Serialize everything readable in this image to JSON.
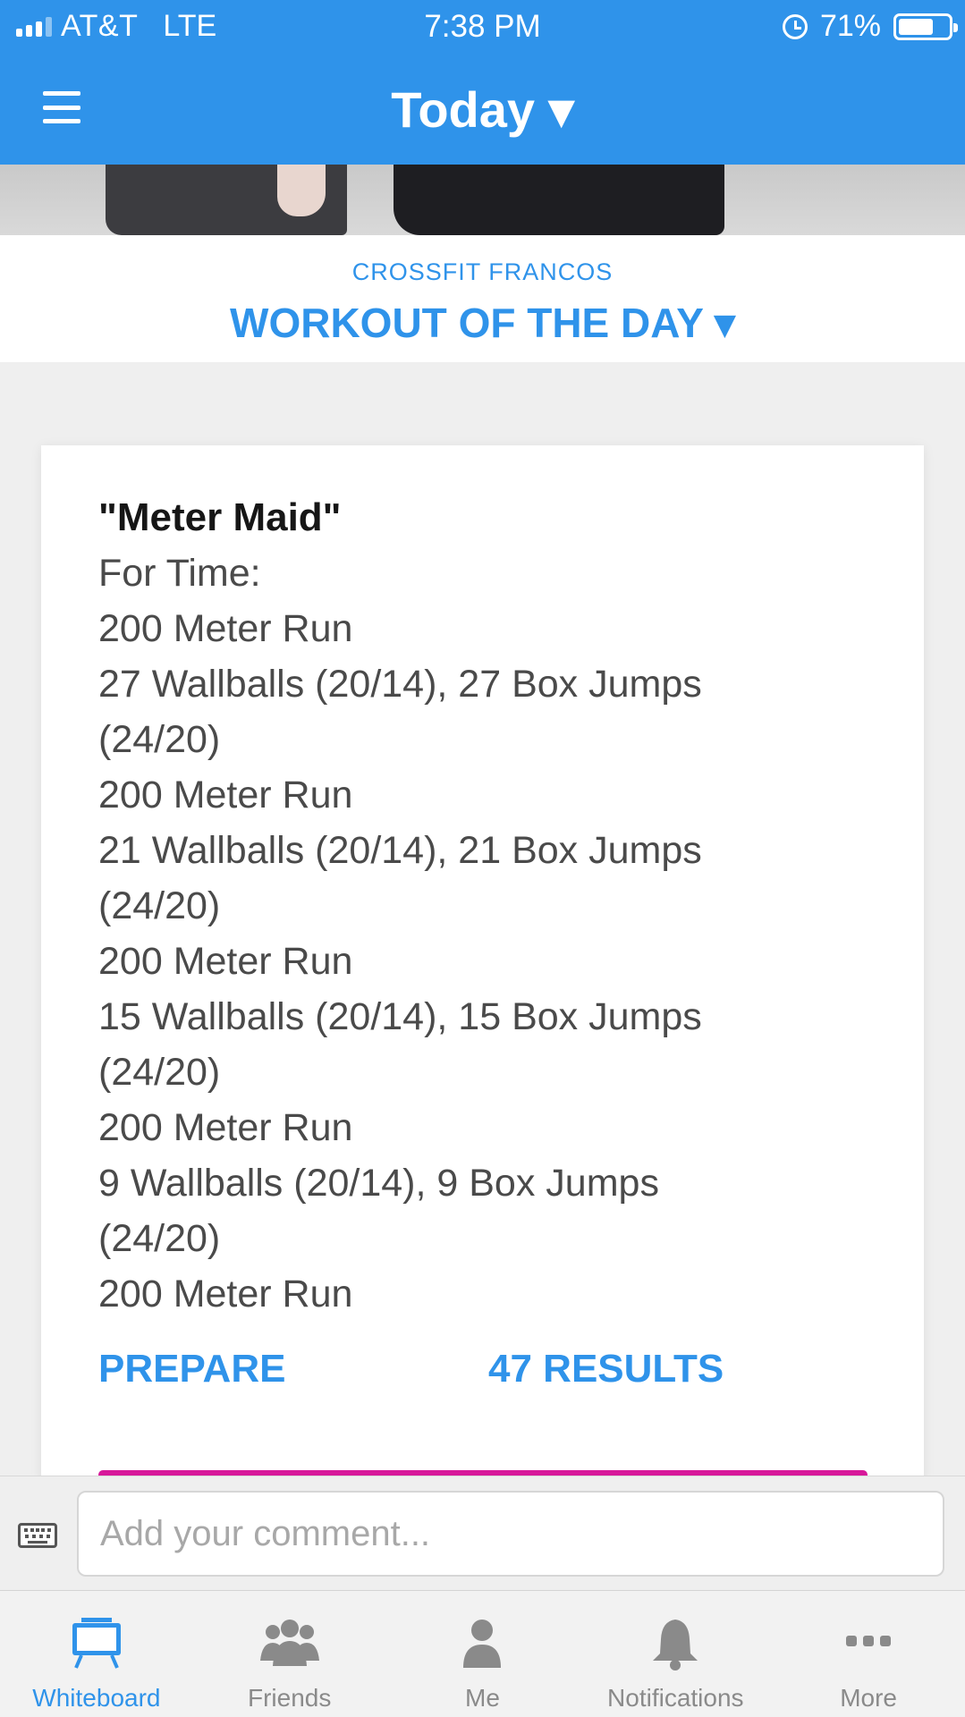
{
  "status_bar": {
    "carrier": "AT&T",
    "network": "LTE",
    "time": "7:38 PM",
    "battery": "71%",
    "battery_level": 0.71
  },
  "nav": {
    "title": "Today ▾",
    "menu_icon": "hamburger-icon"
  },
  "gym": {
    "name": "CROSSFIT FRANCOS",
    "section_title": "WORKOUT OF THE DAY ▾"
  },
  "workout": {
    "name": "\"Meter Maid\"",
    "lines": [
      "For Time:",
      "200 Meter Run",
      "27 Wallballs (20/14), 27 Box Jumps",
      "(24/20)",
      "200 Meter Run",
      "21 Wallballs (20/14), 21 Box Jumps",
      "(24/20)",
      "200 Meter Run",
      "15 Wallballs (20/14), 15 Box Jumps",
      "(24/20)",
      "200 Meter Run",
      "9 Wallballs (20/14), 9 Box Jumps",
      "(24/20)",
      "200 Meter Run"
    ],
    "prepare_label": "PREPARE",
    "results_label": "47 RESULTS"
  },
  "comment": {
    "placeholder": "Add your comment...",
    "value": "",
    "keyboard_icon": "keyboard-icon"
  },
  "tabs": [
    {
      "label": "Whiteboard",
      "icon": "whiteboard-icon",
      "active": true
    },
    {
      "label": "Friends",
      "icon": "friends-icon",
      "active": false
    },
    {
      "label": "Me",
      "icon": "person-icon",
      "active": false
    },
    {
      "label": "Notifications",
      "icon": "bell-icon",
      "active": false
    },
    {
      "label": "More",
      "icon": "more-icon",
      "active": false
    }
  ],
  "colors": {
    "accent": "#2f93ea",
    "header_bg": "#2f93ea",
    "pink": "#d7189a",
    "inactive_tab": "#8a8a8a"
  }
}
